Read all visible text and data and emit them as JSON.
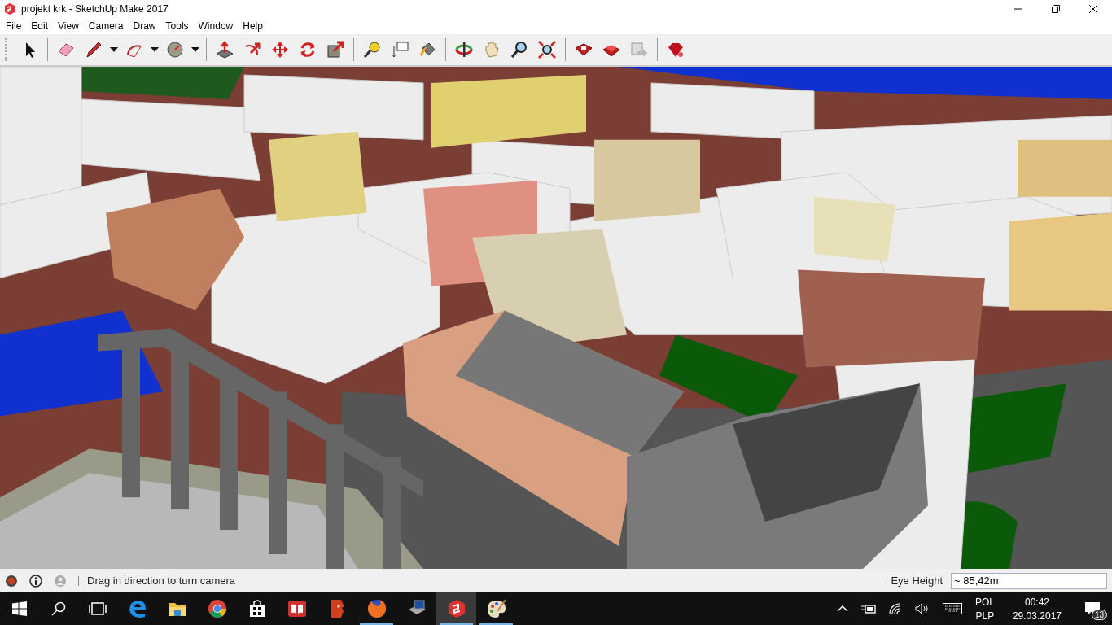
{
  "window": {
    "title": "projekt krk - SketchUp Make 2017"
  },
  "menu": [
    "File",
    "Edit",
    "View",
    "Camera",
    "Draw",
    "Tools",
    "Window",
    "Help"
  ],
  "toolbar": [
    [
      {
        "kind": "select"
      }
    ],
    [
      {
        "kind": "eraser"
      },
      {
        "kind": "pencil"
      },
      {
        "kind": "caret"
      },
      {
        "kind": "arc"
      },
      {
        "kind": "caret"
      },
      {
        "kind": "circle"
      },
      {
        "kind": "caret"
      }
    ],
    [
      {
        "kind": "pushpull"
      },
      {
        "kind": "followme"
      },
      {
        "kind": "move"
      },
      {
        "kind": "rotate"
      },
      {
        "kind": "scale"
      }
    ],
    [
      {
        "kind": "tape"
      },
      {
        "kind": "text"
      },
      {
        "kind": "paint"
      }
    ],
    [
      {
        "kind": "orbit"
      },
      {
        "kind": "pan"
      },
      {
        "kind": "zoom"
      },
      {
        "kind": "extents"
      }
    ],
    [
      {
        "kind": "warehouse"
      },
      {
        "kind": "extension"
      },
      {
        "kind": "layout"
      }
    ],
    [
      {
        "kind": "ruby"
      }
    ]
  ],
  "status_bar": {
    "message": "Drag in direction to turn camera",
    "measure_label": "Eye Height",
    "measure_value": "~ 85,42m"
  },
  "taskbar": {
    "apps": [
      {
        "kind": "edge",
        "running": false,
        "selected": false
      },
      {
        "kind": "folder",
        "running": false,
        "selected": false
      },
      {
        "kind": "chrome",
        "running": false,
        "selected": false
      },
      {
        "kind": "store",
        "running": false,
        "selected": false
      },
      {
        "kind": "book",
        "running": false,
        "selected": false
      },
      {
        "kind": "face",
        "running": false,
        "selected": false
      },
      {
        "kind": "firefox",
        "running": true,
        "selected": false
      },
      {
        "kind": "computer",
        "running": false,
        "selected": false
      },
      {
        "kind": "sketchup",
        "running": true,
        "selected": true
      },
      {
        "kind": "palette",
        "running": true,
        "selected": false
      }
    ],
    "language": [
      "POL",
      "PLP"
    ],
    "time": "00:42",
    "date": "29.03.2017",
    "notifications": "13"
  }
}
